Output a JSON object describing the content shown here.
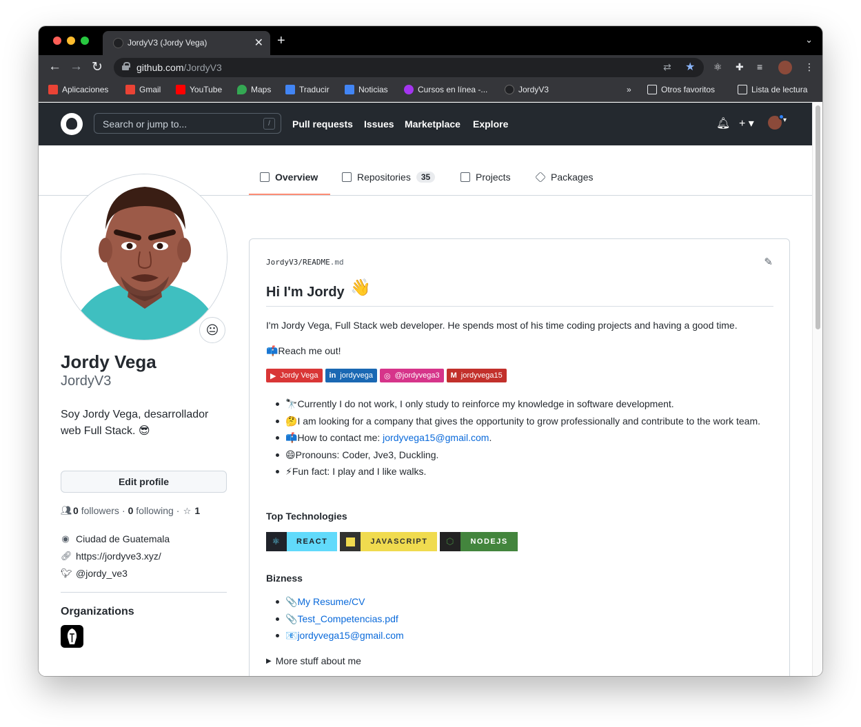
{
  "browser": {
    "tab_title": "JordyV3 (Jordy Vega)",
    "url_domain": "github.com",
    "url_path": "/JordyV3"
  },
  "bookmarks": [
    {
      "label": "Aplicaciones",
      "icon": "apps-grid-icon",
      "color": "#ea4335"
    },
    {
      "label": "Gmail",
      "icon": "gmail-icon",
      "color": "#ea4335"
    },
    {
      "label": "YouTube",
      "icon": "youtube-icon",
      "color": "#ff0000"
    },
    {
      "label": "Maps",
      "icon": "maps-pin-icon",
      "color": "#34a853"
    },
    {
      "label": "Traducir",
      "icon": "translate-icon",
      "color": "#4285f4"
    },
    {
      "label": "Noticias",
      "icon": "news-icon",
      "color": "#4285f4"
    },
    {
      "label": "Cursos en línea -...",
      "icon": "udemy-icon",
      "color": "#a435f0"
    },
    {
      "label": "JordyV3",
      "icon": "github-icon",
      "color": "#24292f"
    }
  ],
  "bookmarks_right": {
    "more": "»",
    "others": "Otros favoritos",
    "reading": "Lista de lectura"
  },
  "header": {
    "search_placeholder": "Search or jump to...",
    "slash_key": "/",
    "nav": [
      "Pull requests",
      "Issues",
      "Marketplace",
      "Explore"
    ]
  },
  "profile_tabs": [
    {
      "label": "Overview",
      "icon": "book-icon",
      "active": true
    },
    {
      "label": "Repositories",
      "icon": "repo-icon",
      "count": "35"
    },
    {
      "label": "Projects",
      "icon": "project-icon"
    },
    {
      "label": "Packages",
      "icon": "package-icon"
    }
  ],
  "profile": {
    "status_emoji": "😐",
    "name": "Jordy Vega",
    "login": "JordyV3",
    "bio": "Soy Jordy Vega, desarrollador web Full Stack. 😎",
    "edit_label": "Edit profile",
    "followers_count": "0",
    "followers_label": "followers",
    "separator": "·",
    "following_count": "0",
    "following_label": "following",
    "stars_count": "1",
    "location": "Ciudad de Guatemala",
    "website": "https://jordyve3.xyz/",
    "twitter": "@jordy_ve3",
    "organizations_label": "Organizations"
  },
  "readme": {
    "path_owner": "JordyV3",
    "path_sep": "/",
    "path_file": "README",
    "path_ext": ".md",
    "h1": "Hi I'm Jordy",
    "wave": "👋",
    "intro": "I'm Jordy Vega, Full Stack web developer. He spends most of his time coding projects and having a good time.",
    "reach": "📫Reach me out!",
    "badges": [
      {
        "label": "Jordy Vega",
        "icon": "youtube-icon",
        "color": "#d93636"
      },
      {
        "label": "jordyvega",
        "icon": "linkedin-icon",
        "color": "#1a68b3"
      },
      {
        "label": "@jordyvega3",
        "icon": "instagram-icon",
        "color": "#d6348a"
      },
      {
        "label": "jordyvega15",
        "icon": "gmail-icon",
        "color": "#c2302b"
      }
    ],
    "bullets": [
      {
        "emoji": "🔭",
        "text": "Currently I do not work, I only study to reinforce my knowledge in software development."
      },
      {
        "emoji": "🤔",
        "text": "I am looking for a company that gives the opportunity to grow professionally and contribute to the work team."
      },
      {
        "emoji": "📫",
        "text": "How to contact me: ",
        "link": "jordyvega15@gmail.com",
        "after": "."
      },
      {
        "emoji": "😄",
        "text": "Pronouns: Coder, Jve3, Duckling."
      },
      {
        "emoji": "⚡",
        "text": "Fun fact: I play and I like walks."
      }
    ],
    "top_tech_label": "Top Technologies",
    "tech": [
      {
        "label": "REACT",
        "icon": "react-icon",
        "color": "#61dafb",
        "text_color": "#20232a"
      },
      {
        "label": "JAVASCRIPT",
        "icon": "js-icon",
        "color": "#f0db4f",
        "text_color": "#323330"
      },
      {
        "label": "NODEJS",
        "icon": "nodejs-icon",
        "color": "#43853d",
        "text_color": "#ffffff"
      }
    ],
    "bizness_label": "Bizness",
    "bizness": [
      {
        "emoji": "📎",
        "link": "My Resume/CV"
      },
      {
        "emoji": "📎",
        "link": "Test_Competencias.pdf"
      },
      {
        "emoji": "📧",
        "link": "jordyvega15@gmail.com"
      }
    ],
    "details": "More stuff about me"
  }
}
